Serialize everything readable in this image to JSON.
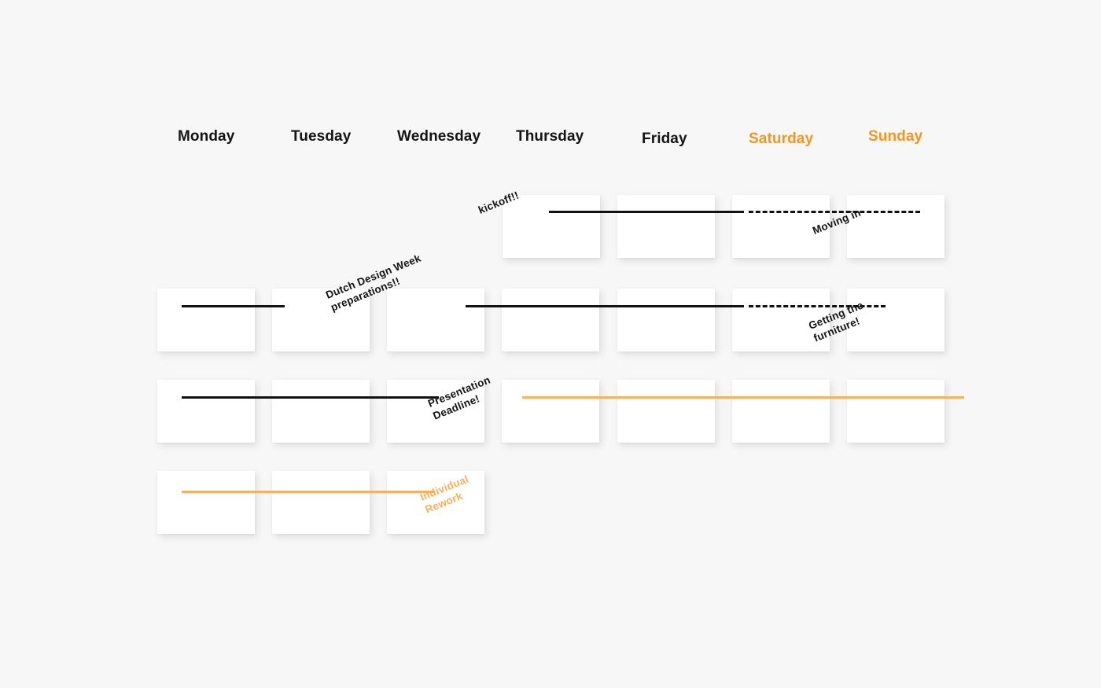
{
  "page": {
    "background_color": "#f7f7f7",
    "accent_color": "#f7941e",
    "bar_orange_color": "#f7b05b",
    "bar_black_color": "#111111"
  },
  "week_header": {
    "days": [
      {
        "label": "Monday",
        "weekend": false
      },
      {
        "label": "Tuesday",
        "weekend": false
      },
      {
        "label": "Wednesday",
        "weekend": false
      },
      {
        "label": "Thursday",
        "weekend": false
      },
      {
        "label": "Friday",
        "weekend": false
      },
      {
        "label": "Saturday",
        "weekend": true
      },
      {
        "label": "Sunday",
        "weekend": true
      }
    ]
  },
  "notes": {
    "kickoff": "kickoff!!",
    "moving_in": "Moving in",
    "dutch_design_week": "Dutch Design Week\npreparations!!",
    "getting_the_furniture": "Getting the\nfurniture!",
    "presentation_deadline": "Presentation\nDeadline!",
    "individual_rework": "Individual\nRework"
  },
  "rows": [
    {
      "index": 1,
      "cards_days": [
        "Thursday",
        "Friday",
        "Saturday",
        "Sunday"
      ],
      "bars": [
        {
          "style": "solid-black",
          "from_day": "Thursday",
          "to_day": "Saturday"
        },
        {
          "style": "dashed-black",
          "from_day": "Saturday",
          "to_day": "Sunday"
        }
      ]
    },
    {
      "index": 2,
      "cards_days": [
        "Monday",
        "Tuesday",
        "Wednesday",
        "Thursday",
        "Friday",
        "Saturday",
        "Sunday"
      ],
      "bars": [
        {
          "style": "solid-black",
          "from_day": "Monday",
          "to_day": "Tuesday"
        },
        {
          "style": "solid-black",
          "from_day": "Wednesday",
          "to_day": "Saturday"
        },
        {
          "style": "dashed-black",
          "from_day": "Saturday",
          "to_day": "Sunday"
        }
      ]
    },
    {
      "index": 3,
      "cards_days": [
        "Monday",
        "Tuesday",
        "Wednesday",
        "Thursday",
        "Friday",
        "Saturday",
        "Sunday"
      ],
      "bars": [
        {
          "style": "solid-black",
          "from_day": "Monday",
          "to_day": "Wednesday"
        },
        {
          "style": "solid-orange",
          "from_day": "Thursday",
          "to_day": "Sunday"
        }
      ]
    },
    {
      "index": 4,
      "cards_days": [
        "Monday",
        "Tuesday",
        "Wednesday"
      ],
      "bars": [
        {
          "style": "solid-orange",
          "from_day": "Monday",
          "to_day": "Wednesday"
        }
      ]
    }
  ]
}
